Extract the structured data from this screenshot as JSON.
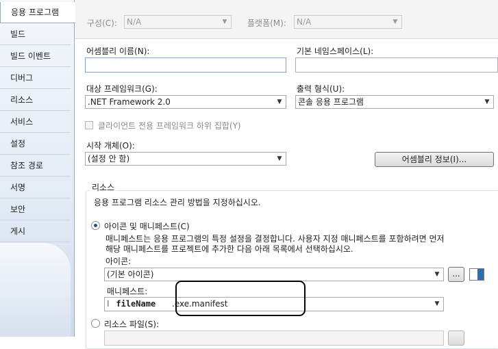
{
  "sidebar": {
    "items": [
      {
        "label": "응용 프로그램",
        "active": true
      },
      {
        "label": "빌드"
      },
      {
        "label": "빌드 이벤트"
      },
      {
        "label": "디버그"
      },
      {
        "label": "리소스"
      },
      {
        "label": "서비스"
      },
      {
        "label": "설정"
      },
      {
        "label": "참조 경로"
      },
      {
        "label": "서명"
      },
      {
        "label": "보안"
      },
      {
        "label": "게시"
      }
    ]
  },
  "config": {
    "configuration_label": "구성(C):",
    "configuration_value": "N/A",
    "platform_label": "플랫폼(M):",
    "platform_value": "N/A"
  },
  "application": {
    "assembly_name_label": "어셈블리 이름(N):",
    "assembly_name_value": "",
    "default_namespace_label": "기본 네임스페이스(L):",
    "default_namespace_value": "",
    "target_framework_label": "대상 프레임워크(G):",
    "target_framework_value": ".NET Framework 2.0",
    "output_type_label": "출력 형식(U):",
    "output_type_value": "콘솔 응용 프로그램",
    "client_only_label": "클라이언트 전용 프레임워크 하위 집합(Y)",
    "startup_object_label": "시작 개체(O):",
    "startup_object_value": "(설정 안 함)",
    "assembly_info_button": "어셈블리 정보(I)..."
  },
  "resources": {
    "group_title": "리소스",
    "description": "응용 프로그램 리소스 관리 방법을 지정하십시오.",
    "icon_manifest_option": "아이콘 및 매니페스트(C)",
    "icon_manifest_desc_1": "매니페스트는 응용 프로그램의 특정 설정을 결정합니다. 사용자 지정 매니페스트를 포함하려면 먼저",
    "icon_manifest_desc_2": "해당 매니페스트를 프로젝트에 추가한 다음 아래 목록에서 선택하십시오.",
    "icon_label": "아이콘:",
    "icon_value": "(기본 아이콘)",
    "browse_button": "...",
    "manifest_label": "매니페스트:",
    "manifest_prefix": "I",
    "manifest_placeholder": "fileName",
    "manifest_suffix": ".exe.manifest",
    "resource_file_option": "리소스 파일(S):"
  }
}
